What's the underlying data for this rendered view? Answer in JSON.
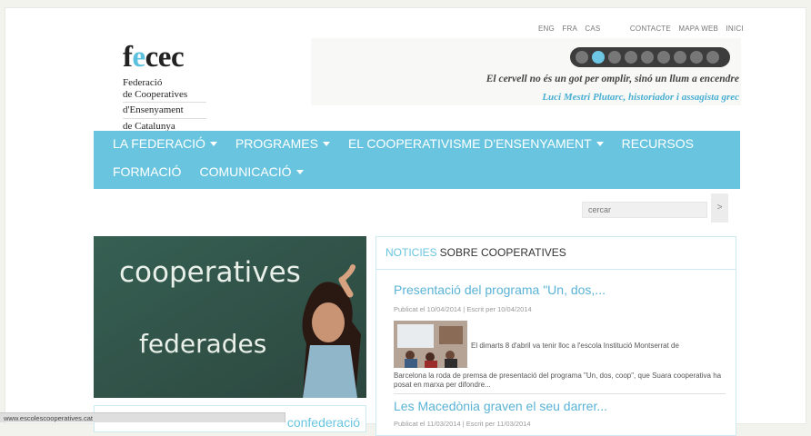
{
  "top_links": {
    "lang": [
      "ENG",
      "FRA",
      "CAS"
    ],
    "links": [
      "CONTACTE",
      "MAPA WEB",
      "INICI"
    ]
  },
  "logo": {
    "word_f": "f",
    "word_e": "e",
    "word_rest": "cec",
    "line1": "Federació",
    "line2": "de Cooperatives",
    "line3": "d'Ensenyament",
    "line4": "de Catalunya"
  },
  "banner": {
    "quote": "El cervell no és un got per omplir, sinó un llum a encendre",
    "author": "Luci Mestri Plutarc, historiador i assagista grec",
    "slide_count": 9,
    "active_slide": 1
  },
  "nav": {
    "row1": [
      {
        "label": "LA FEDERACIÓ",
        "dropdown": true
      },
      {
        "label": "PROGRAMES",
        "dropdown": true
      },
      {
        "label": "EL COOPERATIVISME D'ENSENYAMENT",
        "dropdown": true
      },
      {
        "label": "RECURSOS",
        "dropdown": false
      }
    ],
    "row2": [
      {
        "label": "FORMACIÓ",
        "dropdown": false
      },
      {
        "label": "COMUNICACIÓ",
        "dropdown": true
      }
    ]
  },
  "search": {
    "placeholder": "cercar",
    "button": ">"
  },
  "hero": {
    "line1": "cooperatives",
    "line2": "federades"
  },
  "side_box": {
    "text": "confederació"
  },
  "news": {
    "heading_accent": "NOTICIES",
    "heading_rest": "SOBRE COOPERATIVES",
    "articles": [
      {
        "title": "Presentació del programa \"Un, dos,...",
        "meta": "Publicat el 10/04/2014 | Escrit per 10/04/2014",
        "excerpt_first": "El dimarts 8 d'abril va tenir lloc a l'escola Institució Montserrat de",
        "excerpt_rest": "Barcelona la roda de premsa de presentació del programa \"Un, dos, coop\", que Suara cooperativa ha posat en marxa per difondre..."
      },
      {
        "title": "Les Macedònia graven el seu darrer...",
        "meta": "Publicat el 11/03/2014 | Escrit per 11/03/2014"
      }
    ]
  },
  "statusbar": {
    "url": "www.escolescooperatives.cat"
  },
  "colors": {
    "accent": "#69c5df",
    "link": "#5ab3d6",
    "page_bg": "#f3f3ee"
  }
}
